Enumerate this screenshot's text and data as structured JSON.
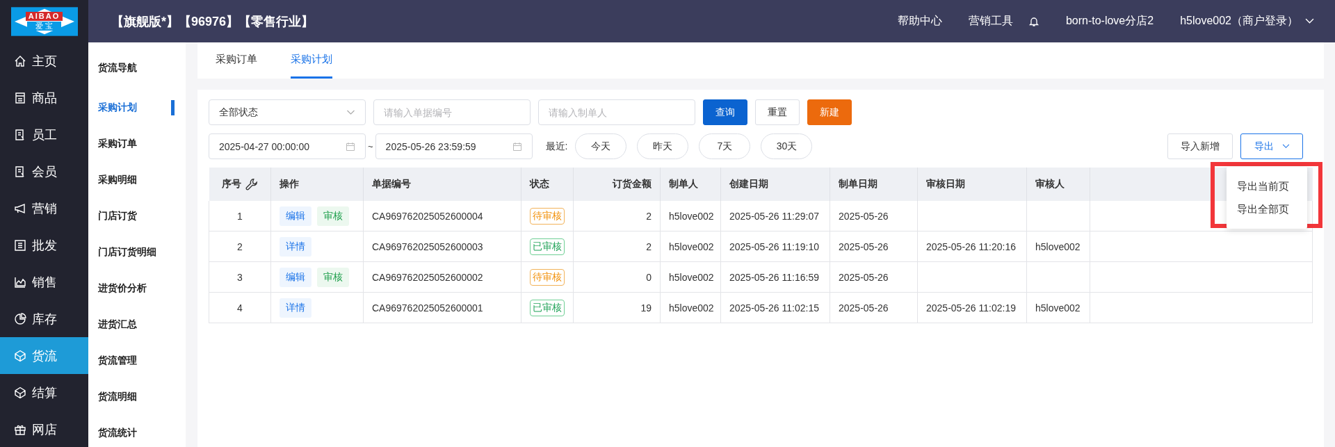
{
  "logo": {
    "top": "AIBAO",
    "bottom": "爱 宝"
  },
  "header": {
    "title": "【旗舰版*】【96976】【零售行业】",
    "links": [
      "帮助中心",
      "营销工具"
    ],
    "store": "born-to-love分店2",
    "user": "h5love002（商户登录）"
  },
  "nav": [
    {
      "label": "主页",
      "selected": false
    },
    {
      "label": "商品",
      "selected": false
    },
    {
      "label": "员工",
      "selected": false
    },
    {
      "label": "会员",
      "selected": false
    },
    {
      "label": "营销",
      "selected": false
    },
    {
      "label": "批发",
      "selected": false
    },
    {
      "label": "销售",
      "selected": false
    },
    {
      "label": "库存",
      "selected": false
    },
    {
      "label": "货流",
      "selected": true
    },
    {
      "label": "结算",
      "selected": false
    },
    {
      "label": "网店",
      "selected": false
    }
  ],
  "subnav": {
    "heading": "货流导航",
    "items": [
      {
        "label": "采购计划",
        "selected": true
      },
      {
        "label": "采购订单",
        "selected": false
      },
      {
        "label": "采购明细",
        "selected": false
      },
      {
        "label": "门店订货",
        "selected": false
      },
      {
        "label": "门店订货明细",
        "selected": false
      },
      {
        "label": "进货价分析",
        "selected": false
      },
      {
        "label": "进货汇总",
        "selected": false
      },
      {
        "label": "货流管理",
        "selected": false
      },
      {
        "label": "货流明细",
        "selected": false
      },
      {
        "label": "货流统计",
        "selected": false
      }
    ]
  },
  "tabs": [
    {
      "label": "采购订单",
      "selected": false
    },
    {
      "label": "采购计划",
      "selected": true
    }
  ],
  "filters": {
    "status": "全部状态",
    "order_no": {
      "placeholder": "请输入单据编号"
    },
    "creator": {
      "placeholder": "请输入制单人"
    },
    "buttons": [
      {
        "label": "查询",
        "kind": "primary"
      },
      {
        "label": "重置",
        "kind": "default"
      },
      {
        "label": "新建",
        "kind": "warning"
      }
    ],
    "date_from": "2025-04-27 00:00:00",
    "date_sep": "~",
    "date_to": "2025-05-26 23:59:59",
    "recent_label": "最近:",
    "recent": [
      "今天",
      "昨天",
      "7天",
      "30天"
    ],
    "import": "导入新增",
    "export": "导出"
  },
  "export_menu": [
    "导出当前页",
    "导出全部页"
  ],
  "table": {
    "columns": [
      "序号",
      "操作",
      "单据编号",
      "状态",
      "订货金额",
      "制单人",
      "创建日期",
      "制单日期",
      "审核日期",
      "审核人"
    ],
    "rows": [
      {
        "index": "1",
        "actions": [
          {
            "label": "编辑",
            "kind": "edit"
          },
          {
            "label": "审核",
            "kind": "review"
          }
        ],
        "order_no": "CA969762025052600004",
        "status": {
          "label": "待审核",
          "kind": "pending"
        },
        "amount": "2",
        "creator": "h5love002",
        "created": "2025-05-26 11:29:07",
        "made": "2025-05-26"
      },
      {
        "index": "2",
        "actions": [
          {
            "label": "详情",
            "kind": "detail"
          }
        ],
        "order_no": "CA969762025052600003",
        "status": {
          "label": "已审核",
          "kind": "approved"
        },
        "amount": "2",
        "creator": "h5love002",
        "created": "2025-05-26 11:19:10",
        "made": "2025-05-26",
        "reviewed": "2025-05-26 11:20:16",
        "reviewer": "h5love002"
      },
      {
        "index": "3",
        "actions": [
          {
            "label": "编辑",
            "kind": "edit"
          },
          {
            "label": "审核",
            "kind": "review"
          }
        ],
        "order_no": "CA969762025052600002",
        "status": {
          "label": "待审核",
          "kind": "pending"
        },
        "amount": "0",
        "creator": "h5love002",
        "created": "2025-05-26 11:16:59",
        "made": "2025-05-26"
      },
      {
        "index": "4",
        "actions": [
          {
            "label": "详情",
            "kind": "detail"
          }
        ],
        "order_no": "CA969762025052600001",
        "status": {
          "label": "已审核",
          "kind": "approved"
        },
        "amount": "19",
        "creator": "h5love002",
        "created": "2025-05-26 11:02:15",
        "made": "2025-05-26",
        "reviewed": "2025-05-26 11:02:19",
        "reviewer": "h5love002"
      }
    ]
  }
}
